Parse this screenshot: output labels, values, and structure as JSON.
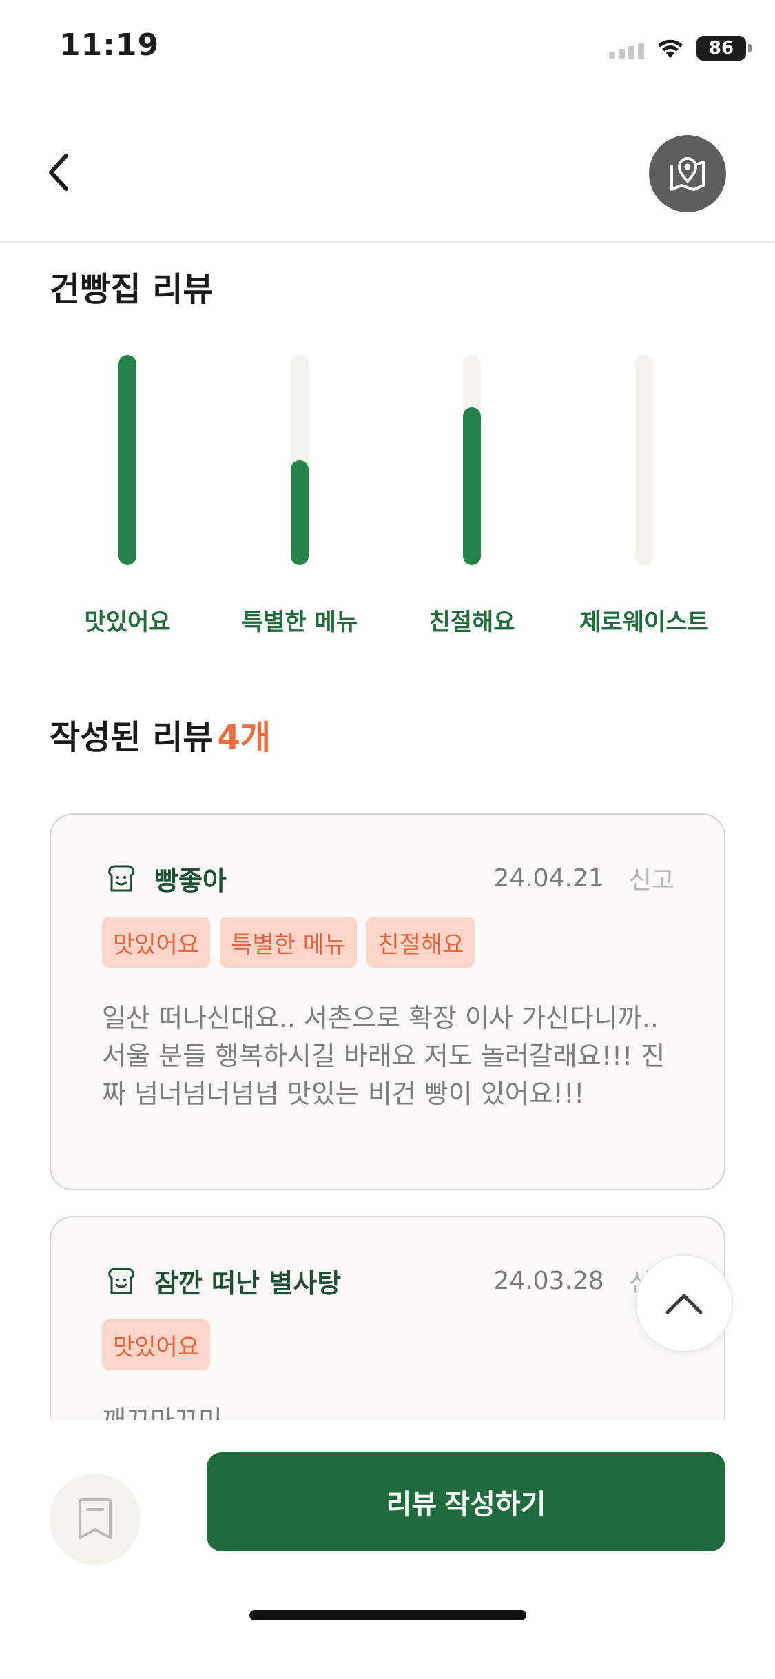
{
  "status_bar": {
    "time": "11:19",
    "battery": "86"
  },
  "page_title": "건빵집 리뷰",
  "chart_data": {
    "type": "bar",
    "categories": [
      "맛있어요",
      "특별한 메뉴",
      "친절해요",
      "제로웨이스트"
    ],
    "values": [
      100,
      50,
      75,
      0
    ],
    "ylim": [
      0,
      100
    ]
  },
  "reviews_section": {
    "heading": "작성된 리뷰",
    "count": "4개"
  },
  "reviews": [
    {
      "nickname": "빵좋아",
      "date": "24.04.21",
      "report": "신고",
      "tags": [
        "맛있어요",
        "특별한 메뉴",
        "친절해요"
      ],
      "body": "일산 떠나신대요.. 서촌으로 확장 이사 가신다니까.. 서울 분들 행복하시길 바래요 저도 놀러갈래요!!! 진짜 넘너넘너넘넘 맛있는 비건 빵이 있어요!!!"
    },
    {
      "nickname": "잠깐 떠난 별사탕",
      "date": "24.03.28",
      "report": "신고",
      "tags": [
        "맛있어요"
      ],
      "body": "깨끄마끄미"
    }
  ],
  "bottom": {
    "write_button": "리뷰 작성하기"
  },
  "icons": {
    "back": "chevron-left-icon",
    "map": "map-pin-icon",
    "avatar": "bread-face-icon",
    "scroll_top": "chevron-up-icon",
    "bookmark": "bookmark-icon"
  },
  "colors": {
    "brand_green": "#1e6b3d",
    "bar_green": "#25834a",
    "accent_orange": "#ee6c3f",
    "tag_bg": "#fdd6c9"
  }
}
